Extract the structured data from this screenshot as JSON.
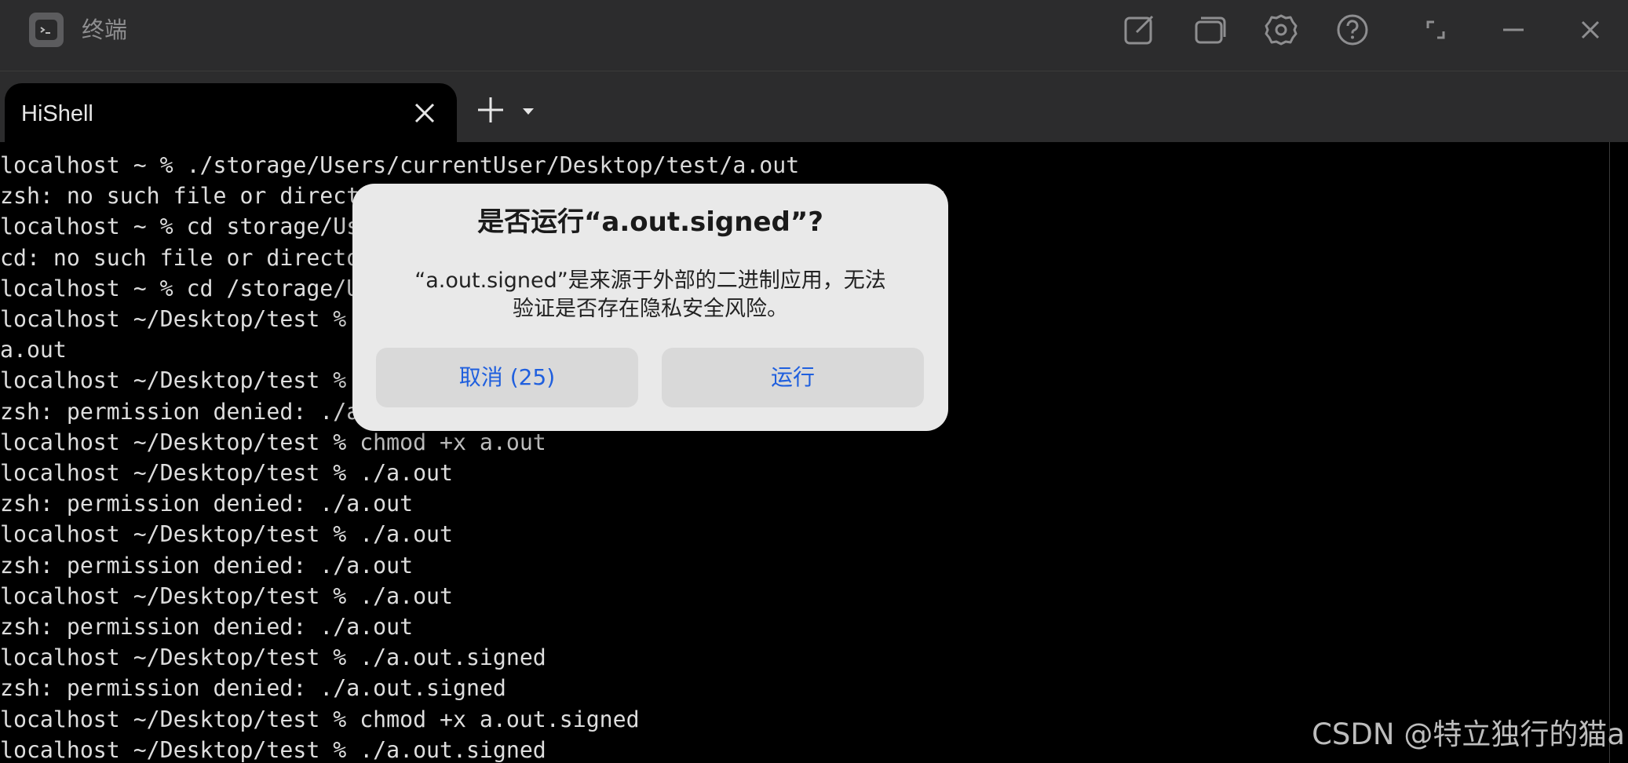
{
  "window": {
    "title": "终端"
  },
  "tabs": [
    {
      "label": "HiShell"
    }
  ],
  "terminal": {
    "lines": [
      "localhost ~ % ./storage/Users/currentUser/Desktop/test/a.out",
      "zsh: no such file or direct                                     t/a.out",
      "localhost ~ % cd storage/Us",
      "cd: no such file or directo",
      "localhost ~ % cd /storage/U",
      "localhost ~/Desktop/test %",
      "a.out",
      "localhost ~/Desktop/test %",
      "zsh: permission denied: ./a",
      "localhost ~/Desktop/test % chmod +x a.out",
      "localhost ~/Desktop/test % ./a.out",
      "zsh: permission denied: ./a.out",
      "localhost ~/Desktop/test % ./a.out",
      "zsh: permission denied: ./a.out",
      "localhost ~/Desktop/test % ./a.out",
      "zsh: permission denied: ./a.out",
      "localhost ~/Desktop/test % ./a.out.signed",
      "zsh: permission denied: ./a.out.signed",
      "localhost ~/Desktop/test % chmod +x a.out.signed",
      "localhost ~/Desktop/test % ./a.out.signed"
    ]
  },
  "dialog": {
    "title": "是否运行“a.out.signed”?",
    "message_line1": "“a.out.signed”是来源于外部的二进制应用，无法",
    "message_line2": "验证是否存在隐私安全风险。",
    "cancel_label": "取消 (25)",
    "run_label": "运行"
  },
  "watermark": "CSDN @特立独行的猫a",
  "icons": {
    "toolbar": [
      "edit-icon",
      "windows-icon",
      "settings-icon",
      "help-icon",
      "fullscreen-icon",
      "minimize-icon",
      "close-icon"
    ],
    "tab": [
      "tab-close-icon",
      "plus-icon",
      "chevron-down-icon"
    ]
  },
  "colors": {
    "titlebar_bg": "#2c2c2d",
    "terminal_bg": "#000000",
    "terminal_text": "#dedede",
    "dialog_bg": "#e9e9e9",
    "dialog_button_bg": "#d9d9d9",
    "dialog_button_text": "#1f5fde",
    "icon": "#8e8e90"
  }
}
